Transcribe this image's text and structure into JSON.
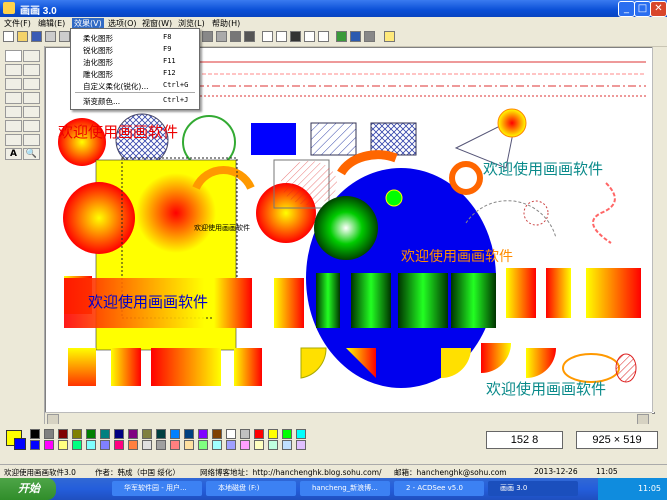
{
  "window": {
    "title": "画画 3.0"
  },
  "menu": [
    "文件(F)",
    "编辑(E)",
    "效果(V)",
    "选项(O)",
    "视窗(W)",
    "浏览(L)",
    "帮助(H)"
  ],
  "effects_menu": {
    "items": [
      {
        "label": "柔化图形",
        "shortcut": "F8"
      },
      {
        "label": "锐化图形",
        "shortcut": "F9"
      },
      {
        "label": "油化图形",
        "shortcut": "F11"
      },
      {
        "label": "雕化图形",
        "shortcut": "F12"
      },
      {
        "label": "自定义柔化(锐化)...",
        "shortcut": "Ctrl+G"
      },
      {
        "label": "渐变颜色...",
        "shortcut": "Ctrl+J"
      }
    ]
  },
  "canvas_texts": {
    "welcome": "欢迎使用画画软件",
    "welcome_small": "欢迎使用画画软件"
  },
  "coords": {
    "position": "152 8",
    "size": "925 × 519"
  },
  "status": {
    "hint": "欢迎使用画画软件3.0",
    "author": "作者：韩成（中国 绥化）",
    "blog": "网络博客地址：http://hanchenghk.blog.sohu.com/",
    "email": "邮箱：hanchenghk@sohu.com",
    "date": "2013-12-26",
    "time": "11:05"
  },
  "taskbar": {
    "start": "开始",
    "tasks": [
      "华军软件园 - 用户...",
      "本地磁盘 (F:)",
      "hancheng_新浪博...",
      "2 - ACDSee v5.0",
      "画画 3.0"
    ],
    "clock": "11:05"
  },
  "palette_colors": [
    "#000000",
    "#808080",
    "#800000",
    "#808000",
    "#008000",
    "#008080",
    "#000080",
    "#800080",
    "#808040",
    "#004040",
    "#0080ff",
    "#004080",
    "#8000ff",
    "#804000",
    "#ffffff",
    "#c0c0c0",
    "#ff0000",
    "#ffff00",
    "#00ff00",
    "#00ffff",
    "#0000ff",
    "#ff00ff",
    "#ffff80",
    "#00ff80",
    "#80ffff",
    "#8080ff",
    "#ff0080",
    "#ff8040",
    "#e0e0e0",
    "#a0a0a0",
    "#ff8080",
    "#ffe0a0",
    "#80ff80",
    "#a0ffff",
    "#a0a0ff",
    "#ffa0ff",
    "#ffffc0",
    "#c0ffe0",
    "#c0e0ff",
    "#e0c0ff"
  ],
  "colors": {
    "primary": "#ffff00",
    "secondary": "#0000ff"
  }
}
